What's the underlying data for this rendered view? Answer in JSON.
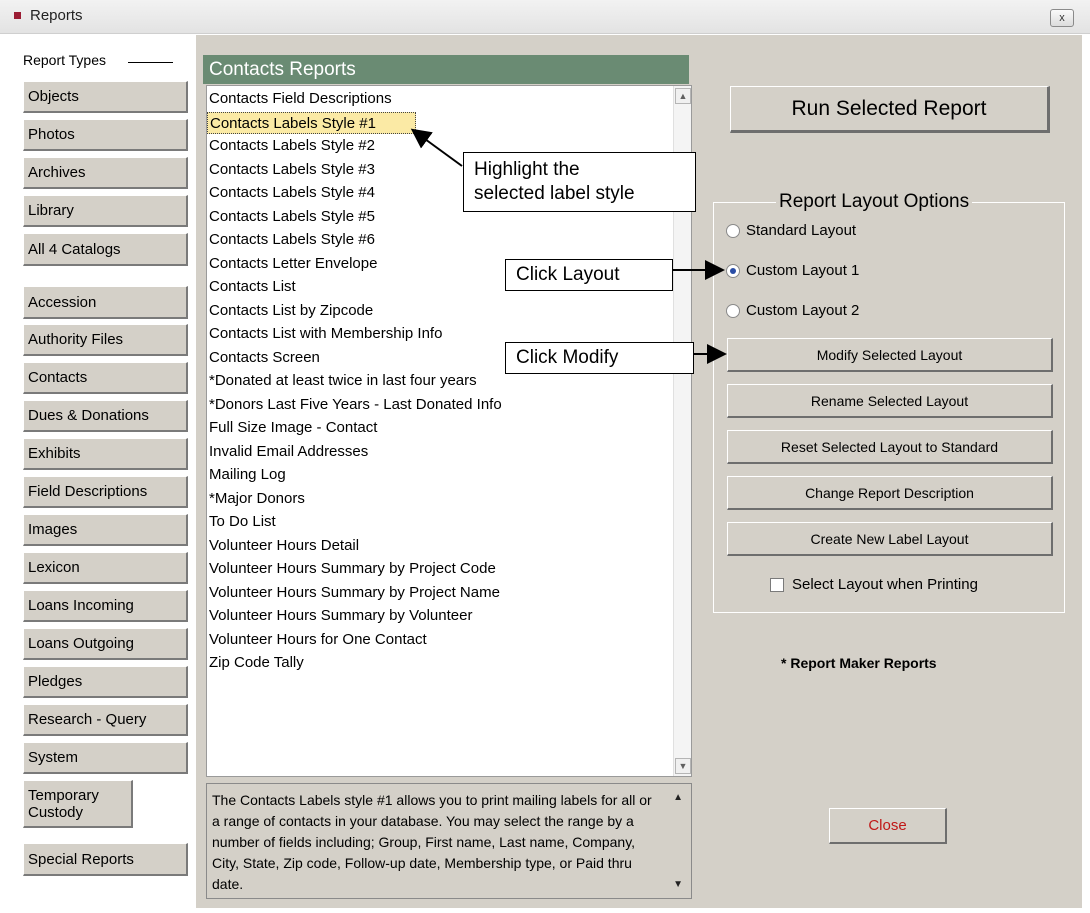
{
  "window": {
    "title": "Reports",
    "close_label": "x"
  },
  "sidebar": {
    "header": "Report Types",
    "items": [
      "Objects",
      "Photos",
      "Archives",
      "Library",
      "All 4 Catalogs",
      "Accession",
      "Authority Files",
      "Contacts",
      "Dues & Donations",
      "Exhibits",
      "Field Descriptions",
      "Images",
      "Lexicon",
      "Loans Incoming",
      "Loans Outgoing",
      "Pledges",
      "Research - Query",
      "System",
      "Temporary Custody",
      "Special Reports"
    ]
  },
  "reports": {
    "title": "Contacts Reports",
    "selected_index": 1,
    "items": [
      "Contacts Field Descriptions",
      "Contacts Labels Style #1",
      "Contacts Labels Style #2",
      "Contacts Labels Style #3",
      "Contacts Labels Style #4",
      "Contacts Labels Style #5",
      "Contacts Labels Style #6",
      "Contacts Letter Envelope",
      "Contacts List",
      "Contacts List by Zipcode",
      "Contacts List with Membership Info",
      "Contacts Screen",
      "*Donated at least twice in last four years",
      "*Donors Last Five Years - Last Donated Info",
      "Full Size Image - Contact",
      "Invalid Email Addresses",
      "Mailing Log",
      "*Major Donors",
      "To Do List",
      "Volunteer Hours Detail",
      "Volunteer Hours Summary by Project Code",
      "Volunteer Hours Summary by Project Name",
      "Volunteer Hours Summary by Volunteer",
      "Volunteer Hours for One Contact",
      "Zip Code Tally"
    ],
    "description": "The Contacts Labels style #1 allows you to print mailing labels for all or a range of contacts in your database.  You may select the range by a number of fields including; Group, First name, Last name, Company, City, State, Zip code, Follow-up date, Membership type, or Paid thru date."
  },
  "actions": {
    "run_label": "Run Selected Report",
    "close_label": "Close",
    "report_maker_note": "* Report Maker Reports"
  },
  "layout_options": {
    "title": "Report Layout Options",
    "radios": [
      {
        "label": "Standard Layout",
        "checked": false
      },
      {
        "label": "Custom Layout 1",
        "checked": true
      },
      {
        "label": "Custom Layout 2",
        "checked": false
      }
    ],
    "buttons": [
      "Modify Selected Layout",
      "Rename Selected Layout",
      "Reset Selected Layout to Standard",
      "Change Report Description",
      "Create New Label Layout"
    ],
    "checkbox_label": "Select Layout when Printing",
    "checkbox_checked": false
  },
  "callouts": {
    "highlight_line1": "Highlight the",
    "highlight_line2": "selected label style",
    "layout": "Click Layout",
    "modify": "Click Modify"
  },
  "colors": {
    "header_green": "#6a8b73",
    "selection": "#fbeaa5",
    "close_red": "#c01818",
    "panel": "#d4d0c8"
  }
}
